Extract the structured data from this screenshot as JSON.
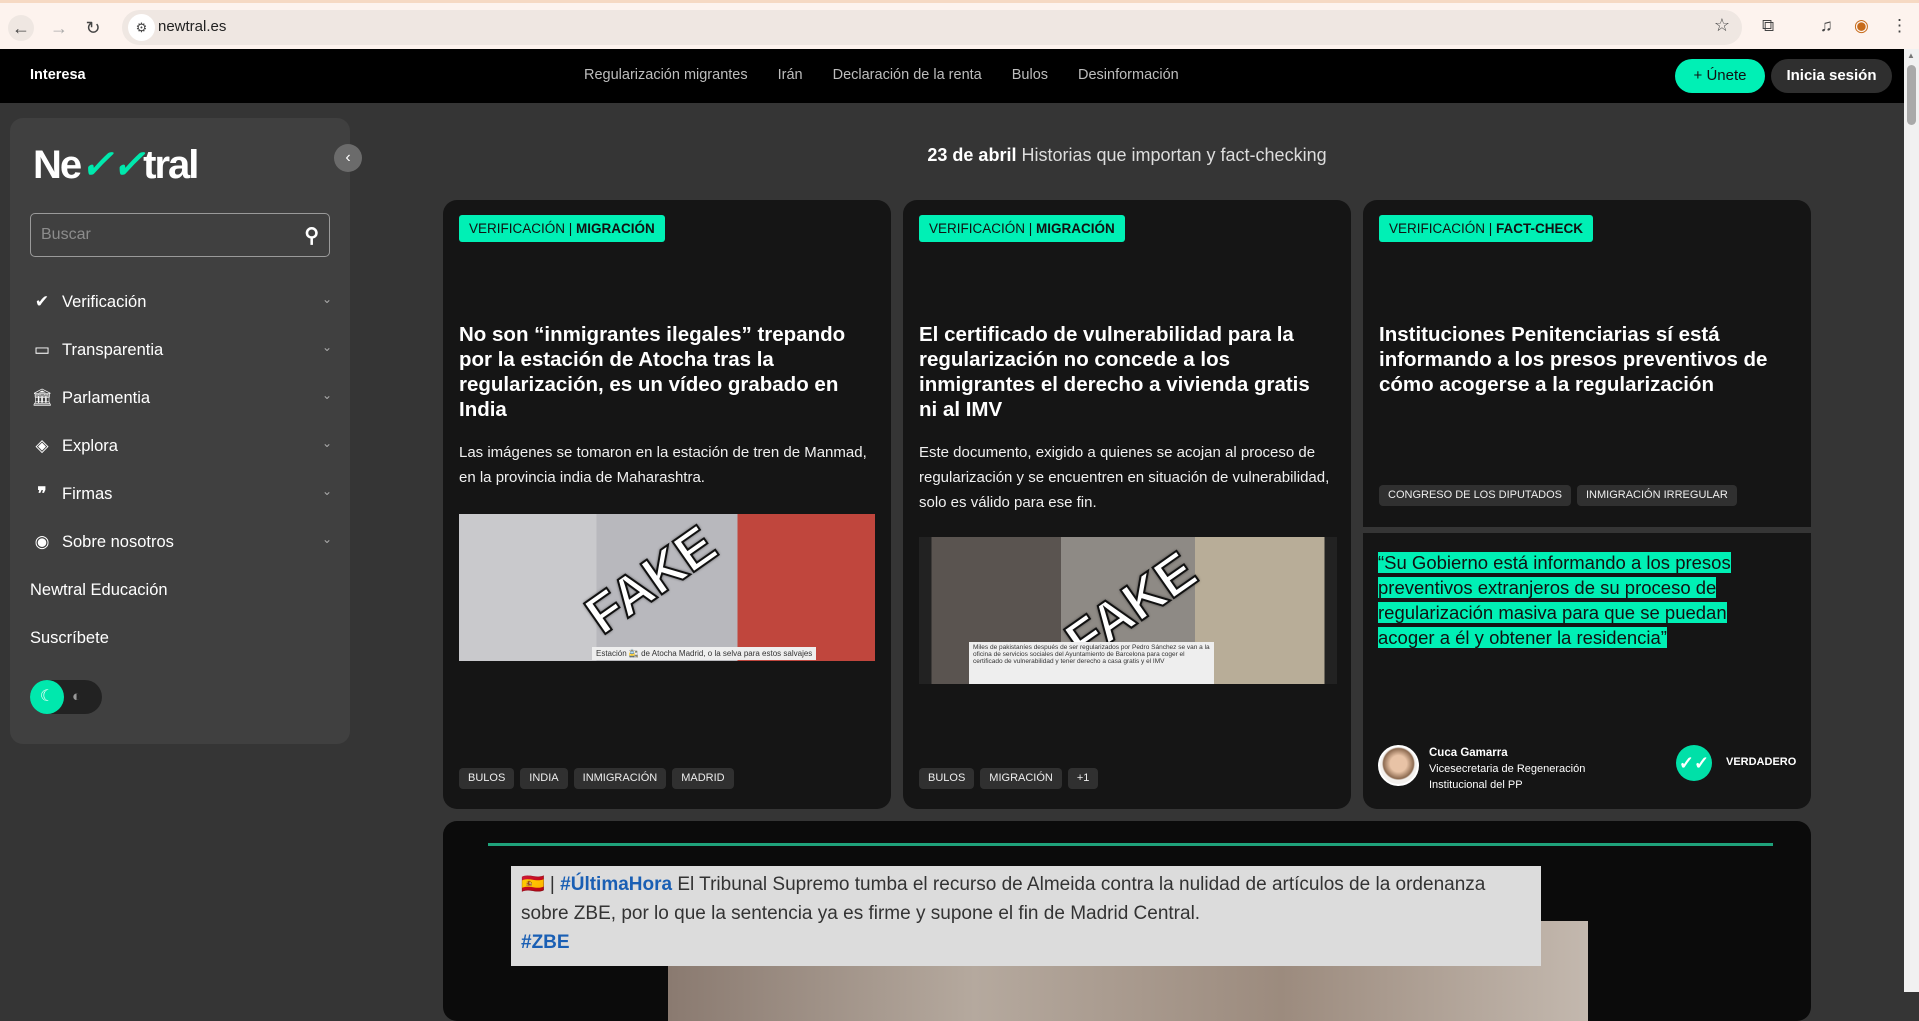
{
  "browser": {
    "url": "newtral.es"
  },
  "nav": {
    "brand": "Interesa",
    "links": [
      "Regularización migrantes",
      "Irán",
      "Declaración de la renta",
      "Bulos",
      "Desinformación"
    ],
    "join": "+ Únete",
    "login": "Inicia sesión"
  },
  "sidebar": {
    "logo": "Newtral",
    "search_placeholder": "Buscar",
    "items": [
      {
        "label": "Verificación",
        "icon": "verified-badge-icon"
      },
      {
        "label": "Transparentia",
        "icon": "document-icon"
      },
      {
        "label": "Parlamentia",
        "icon": "parliament-icon"
      },
      {
        "label": "Explora",
        "icon": "compass-icon"
      },
      {
        "label": "Firmas",
        "icon": "quote-icon"
      },
      {
        "label": "Sobre nosotros",
        "icon": "broadcast-icon"
      }
    ],
    "links": [
      "Newtral Educación",
      "Suscríbete"
    ]
  },
  "header": {
    "date": "23 de abril",
    "subtitle": " Historias que importan y fact-checking"
  },
  "cards": [
    {
      "section": "VERIFICACIÓN",
      "category": "MIGRACIÓN",
      "title": "No son “inmigrantes ilegales” trepando por la estación de Atocha tras la regularización, es un vídeo grabado en India",
      "description": "Las imágenes se tomaron en la estación de tren de Manmad, en la provincia india de Maharashtra.",
      "image_stamp": "FAKE",
      "image_caption": "Estación 🚉 de Atocha Madrid, o la selva para estos salvajes",
      "tags": [
        "BULOS",
        "INDIA",
        "INMIGRACIÓN",
        "MADRID"
      ]
    },
    {
      "section": "VERIFICACIÓN",
      "category": "MIGRACIÓN",
      "title": "El certificado de vulnerabilidad para la regularización no concede a los inmigrantes el derecho a vivienda gratis ni al IMV",
      "description": "Este documento, exigido a quienes se acojan al proceso de regularización y se encuentren en situación de vulnerabilidad, solo es válido para ese fin.",
      "image_stamp": "FAKE",
      "image_caption": "Miles de pakistaníes después de ser regularizados por Pedro Sánchez se van a la oficina de servicios sociales del Ayuntamiento de Barcelona para coger el certificado de vulnerabilidad y tener derecho a casa gratis y el IMV",
      "tags": [
        "BULOS",
        "MIGRACIÓN",
        "+1"
      ]
    },
    {
      "section": "VERIFICACIÓN",
      "category": "FACT-CHECK",
      "title": "Instituciones Penitenciarias sí está informando a los presos preventivos de cómo acogerse a la regularización",
      "tags": [
        "CONGRESO DE LOS DIPUTADOS",
        "INMIGRACIÓN IRREGULAR"
      ],
      "quote": "“Su Gobierno está informando a los presos preventivos extranjeros de su proceso de regularización masiva para que se puedan acoger a él y obtener la residencia”",
      "author": "Cuca Gamarra",
      "author_role": "Vicesecretaria de Regeneración Institucional del PP",
      "verdict": "VERDADERO"
    }
  ],
  "video": {
    "hashtag": "#ÚltimaHora",
    "text": " El Tribunal Supremo tumba el recurso de Almeida contra la nulidad de artículos de la ordenanza sobre ZBE, por lo que la sentencia ya es firme y supone el fin de Madrid Central.",
    "hashtag2": "#ZBE",
    "flag": "🇪🇸 |"
  },
  "colors": {
    "accent": "#00f0b5",
    "background": "#353535",
    "card": "#151515"
  }
}
